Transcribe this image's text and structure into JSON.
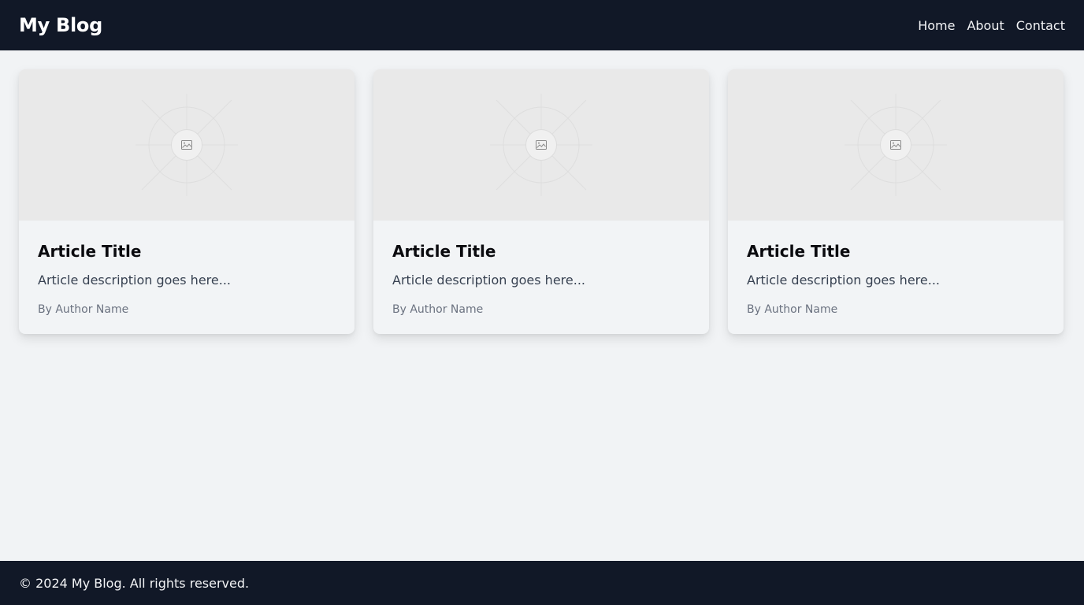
{
  "header": {
    "title": "My Blog",
    "nav": [
      {
        "label": "Home"
      },
      {
        "label": "About"
      },
      {
        "label": "Contact"
      }
    ]
  },
  "cards": [
    {
      "title": "Article Title",
      "description": "Article description goes here...",
      "author": "By Author Name",
      "image_icon": "image-placeholder-icon"
    },
    {
      "title": "Article Title",
      "description": "Article description goes here...",
      "author": "By Author Name",
      "image_icon": "image-placeholder-icon"
    },
    {
      "title": "Article Title",
      "description": "Article description goes here...",
      "author": "By Author Name",
      "image_icon": "image-placeholder-icon"
    }
  ],
  "footer": {
    "text": "© 2024 My Blog. All rights reserved."
  },
  "colors": {
    "header_bg": "#111827",
    "page_bg": "#f1f3f5",
    "card_bg": "#f2f4f6",
    "thumb_bg": "#e9e9e9",
    "title": "#0b0b0f",
    "description": "#374151",
    "author": "#6b7280"
  }
}
